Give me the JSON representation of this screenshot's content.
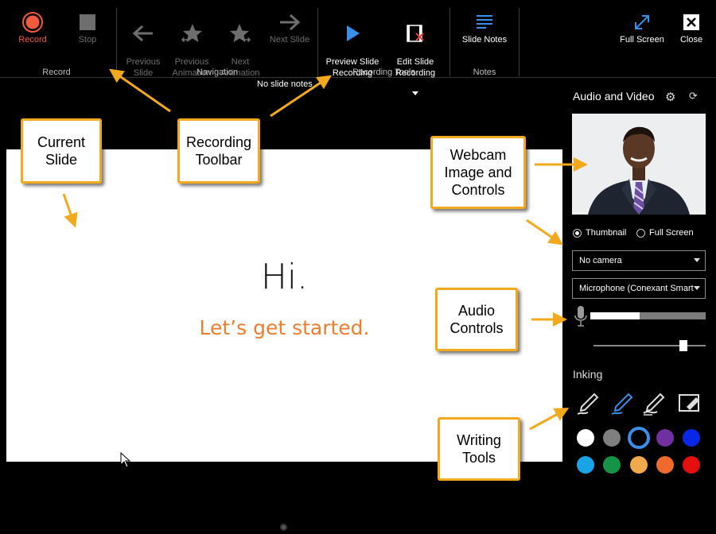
{
  "ribbon": {
    "record": {
      "label": "Record",
      "icon": "record-icon"
    },
    "stop": {
      "label": "Stop",
      "icon": "stop-icon"
    },
    "prev_slide": {
      "label": "Previous\nSlide",
      "icon": "arrow-left-icon"
    },
    "prev_anim": {
      "label": "Previous\nAnimation",
      "icon": "star-left-icon"
    },
    "next_anim": {
      "label": "Next\nAnimation",
      "icon": "star-right-icon"
    },
    "next_slide": {
      "label": "Next Slide",
      "icon": "arrow-right-icon"
    },
    "preview": {
      "label": "Preview Slide\nRecording",
      "icon": "play-icon"
    },
    "edit": {
      "label": "Edit Slide\nRecording",
      "icon": "film-edit-icon"
    },
    "notes": {
      "label": "Slide Notes",
      "icon": "notes-icon"
    },
    "fullscreen": {
      "label": "Full Screen",
      "icon": "expand-icon"
    },
    "close": {
      "label": "Close",
      "icon": "close-icon"
    },
    "groups": [
      "Record",
      "Navigation",
      "Recording Tools",
      "Notes"
    ],
    "no_notes": "No slide notes"
  },
  "slide": {
    "title": "Hi.",
    "subtitle": "Let’s get started."
  },
  "panel": {
    "title": "Audio and Video",
    "view_options": [
      {
        "label": "Thumbnail",
        "selected": true
      },
      {
        "label": "Full Screen",
        "selected": false
      }
    ],
    "camera": "No camera",
    "microphone": "Microphone (Conexant Smart",
    "mic_level": 0.43,
    "volume": 0.8,
    "inking_title": "Inking",
    "tools": [
      "pen-icon",
      "highlighter-icon",
      "eraser-pen-icon",
      "clear-ink-icon"
    ],
    "colors": [
      "#ffffff",
      "#7f7f7f",
      "#3a8fe8",
      "#7030a0",
      "#0a26e6",
      "#1aa3e6",
      "#159447",
      "#f2a94d",
      "#ef6a2c",
      "#e60f0f"
    ],
    "selected_color": 2
  },
  "callouts": {
    "current_slide": "Current\nSlide",
    "recording_toolbar": "Recording\nToolbar",
    "webcam": "Webcam\nImage and\nControls",
    "audio": "Audio\nControls",
    "writing": "Writing\nTools"
  },
  "accent": "#f2a91e"
}
